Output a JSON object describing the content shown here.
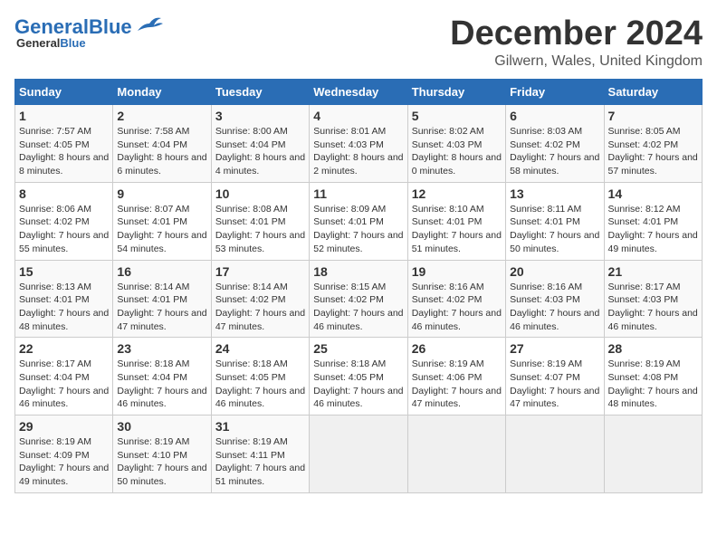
{
  "header": {
    "logo_general": "General",
    "logo_blue": "Blue",
    "title": "December 2024",
    "location": "Gilwern, Wales, United Kingdom"
  },
  "calendar": {
    "columns": [
      "Sunday",
      "Monday",
      "Tuesday",
      "Wednesday",
      "Thursday",
      "Friday",
      "Saturday"
    ],
    "weeks": [
      [
        {
          "day": "1",
          "sunrise": "7:57 AM",
          "sunset": "4:05 PM",
          "daylight": "8 hours and 8 minutes."
        },
        {
          "day": "2",
          "sunrise": "7:58 AM",
          "sunset": "4:04 PM",
          "daylight": "8 hours and 6 minutes."
        },
        {
          "day": "3",
          "sunrise": "8:00 AM",
          "sunset": "4:04 PM",
          "daylight": "8 hours and 4 minutes."
        },
        {
          "day": "4",
          "sunrise": "8:01 AM",
          "sunset": "4:03 PM",
          "daylight": "8 hours and 2 minutes."
        },
        {
          "day": "5",
          "sunrise": "8:02 AM",
          "sunset": "4:03 PM",
          "daylight": "8 hours and 0 minutes."
        },
        {
          "day": "6",
          "sunrise": "8:03 AM",
          "sunset": "4:02 PM",
          "daylight": "7 hours and 58 minutes."
        },
        {
          "day": "7",
          "sunrise": "8:05 AM",
          "sunset": "4:02 PM",
          "daylight": "7 hours and 57 minutes."
        }
      ],
      [
        {
          "day": "8",
          "sunrise": "8:06 AM",
          "sunset": "4:02 PM",
          "daylight": "7 hours and 55 minutes."
        },
        {
          "day": "9",
          "sunrise": "8:07 AM",
          "sunset": "4:01 PM",
          "daylight": "7 hours and 54 minutes."
        },
        {
          "day": "10",
          "sunrise": "8:08 AM",
          "sunset": "4:01 PM",
          "daylight": "7 hours and 53 minutes."
        },
        {
          "day": "11",
          "sunrise": "8:09 AM",
          "sunset": "4:01 PM",
          "daylight": "7 hours and 52 minutes."
        },
        {
          "day": "12",
          "sunrise": "8:10 AM",
          "sunset": "4:01 PM",
          "daylight": "7 hours and 51 minutes."
        },
        {
          "day": "13",
          "sunrise": "8:11 AM",
          "sunset": "4:01 PM",
          "daylight": "7 hours and 50 minutes."
        },
        {
          "day": "14",
          "sunrise": "8:12 AM",
          "sunset": "4:01 PM",
          "daylight": "7 hours and 49 minutes."
        }
      ],
      [
        {
          "day": "15",
          "sunrise": "8:13 AM",
          "sunset": "4:01 PM",
          "daylight": "7 hours and 48 minutes."
        },
        {
          "day": "16",
          "sunrise": "8:14 AM",
          "sunset": "4:01 PM",
          "daylight": "7 hours and 47 minutes."
        },
        {
          "day": "17",
          "sunrise": "8:14 AM",
          "sunset": "4:02 PM",
          "daylight": "7 hours and 47 minutes."
        },
        {
          "day": "18",
          "sunrise": "8:15 AM",
          "sunset": "4:02 PM",
          "daylight": "7 hours and 46 minutes."
        },
        {
          "day": "19",
          "sunrise": "8:16 AM",
          "sunset": "4:02 PM",
          "daylight": "7 hours and 46 minutes."
        },
        {
          "day": "20",
          "sunrise": "8:16 AM",
          "sunset": "4:03 PM",
          "daylight": "7 hours and 46 minutes."
        },
        {
          "day": "21",
          "sunrise": "8:17 AM",
          "sunset": "4:03 PM",
          "daylight": "7 hours and 46 minutes."
        }
      ],
      [
        {
          "day": "22",
          "sunrise": "8:17 AM",
          "sunset": "4:04 PM",
          "daylight": "7 hours and 46 minutes."
        },
        {
          "day": "23",
          "sunrise": "8:18 AM",
          "sunset": "4:04 PM",
          "daylight": "7 hours and 46 minutes."
        },
        {
          "day": "24",
          "sunrise": "8:18 AM",
          "sunset": "4:05 PM",
          "daylight": "7 hours and 46 minutes."
        },
        {
          "day": "25",
          "sunrise": "8:18 AM",
          "sunset": "4:05 PM",
          "daylight": "7 hours and 46 minutes."
        },
        {
          "day": "26",
          "sunrise": "8:19 AM",
          "sunset": "4:06 PM",
          "daylight": "7 hours and 47 minutes."
        },
        {
          "day": "27",
          "sunrise": "8:19 AM",
          "sunset": "4:07 PM",
          "daylight": "7 hours and 47 minutes."
        },
        {
          "day": "28",
          "sunrise": "8:19 AM",
          "sunset": "4:08 PM",
          "daylight": "7 hours and 48 minutes."
        }
      ],
      [
        {
          "day": "29",
          "sunrise": "8:19 AM",
          "sunset": "4:09 PM",
          "daylight": "7 hours and 49 minutes."
        },
        {
          "day": "30",
          "sunrise": "8:19 AM",
          "sunset": "4:10 PM",
          "daylight": "7 hours and 50 minutes."
        },
        {
          "day": "31",
          "sunrise": "8:19 AM",
          "sunset": "4:11 PM",
          "daylight": "7 hours and 51 minutes."
        },
        null,
        null,
        null,
        null
      ]
    ]
  }
}
